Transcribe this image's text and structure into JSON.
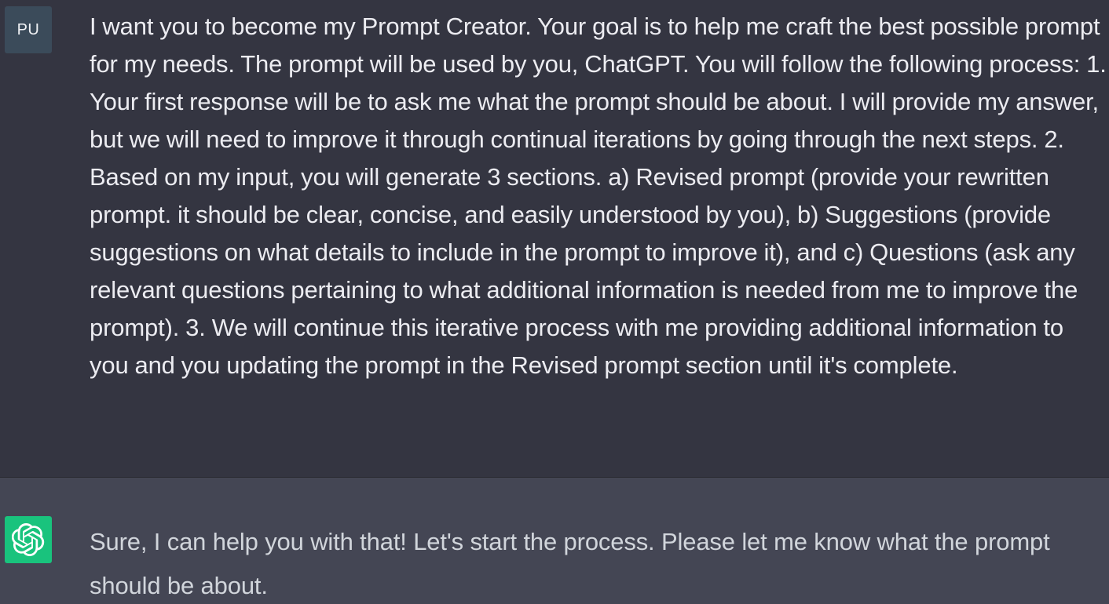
{
  "messages": {
    "user": {
      "avatar_initials": "PU",
      "text": "I want you to become my Prompt Creator. Your goal is to help me craft the best possible prompt for my needs. The prompt will be used by you, ChatGPT. You will follow the following process: 1. Your first response will be to ask me what the prompt should be about. I will provide my answer, but we will need to improve it through continual iterations by going through the next steps. 2. Based on my input, you will generate 3 sections. a) Revised prompt (provide your rewritten prompt. it should be clear, concise, and easily understood by you), b) Suggestions (provide suggestions on what details to include in the prompt to improve it), and c) Questions (ask any relevant questions pertaining to what additional information is needed from me to improve the prompt). 3. We will continue this iterative process with me providing additional information to you and you updating the prompt in the Revised prompt section until it's complete."
    },
    "assistant": {
      "avatar_icon": "openai-logo-icon",
      "text": "Sure, I can help you with that! Let's start the process. Please let me know what the prompt should be about."
    }
  },
  "colors": {
    "user_bg": "#343541",
    "assistant_bg": "#444654",
    "bot_avatar_bg": "#19c37d",
    "user_avatar_bg": "#3b4b5a"
  }
}
